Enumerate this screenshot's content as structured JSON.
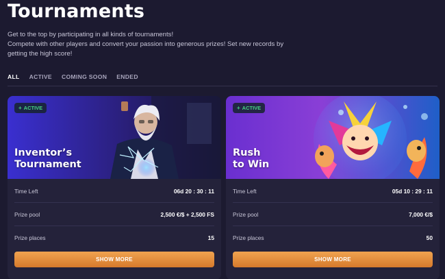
{
  "page": {
    "title": "Tournaments",
    "description": [
      "Get to the top by participating in all kinds of tournaments!",
      "Compete with other players and convert your passion into generous prizes! Set new records by getting the high score!"
    ]
  },
  "tabs": [
    {
      "label": "ALL",
      "active": true
    },
    {
      "label": "ACTIVE",
      "active": false
    },
    {
      "label": "COMING SOON",
      "active": false
    },
    {
      "label": "ENDED",
      "active": false
    }
  ],
  "cards": [
    {
      "status": "ACTIVE",
      "status_icon": "plus-icon",
      "title_line1": "Inventor’s",
      "title_line2": "Tournament",
      "time_left_label": "Time Left",
      "time_left_value": "06d  20 : 30 : 11",
      "prize_pool_label": "Prize pool",
      "prize_pool_value": "2,500 €/$ + 2,500 FS",
      "prize_places_label": "Prize places",
      "prize_places_value": "15",
      "button_label": "SHOW MORE"
    },
    {
      "status": "ACTIVE",
      "status_icon": "plus-icon",
      "title_line1": "Rush",
      "title_line2": "to Win",
      "time_left_label": "Time Left",
      "time_left_value": "05d  10 : 29 : 11",
      "prize_pool_label": "Prize pool",
      "prize_pool_value": "7,000 €/$",
      "prize_places_label": "Prize places",
      "prize_places_value": "50",
      "button_label": "SHOW MORE"
    }
  ],
  "colors": {
    "background": "#1c1a30",
    "card": "#24223a",
    "accent_button": "#e58d3c",
    "active_badge": "#45d483"
  }
}
